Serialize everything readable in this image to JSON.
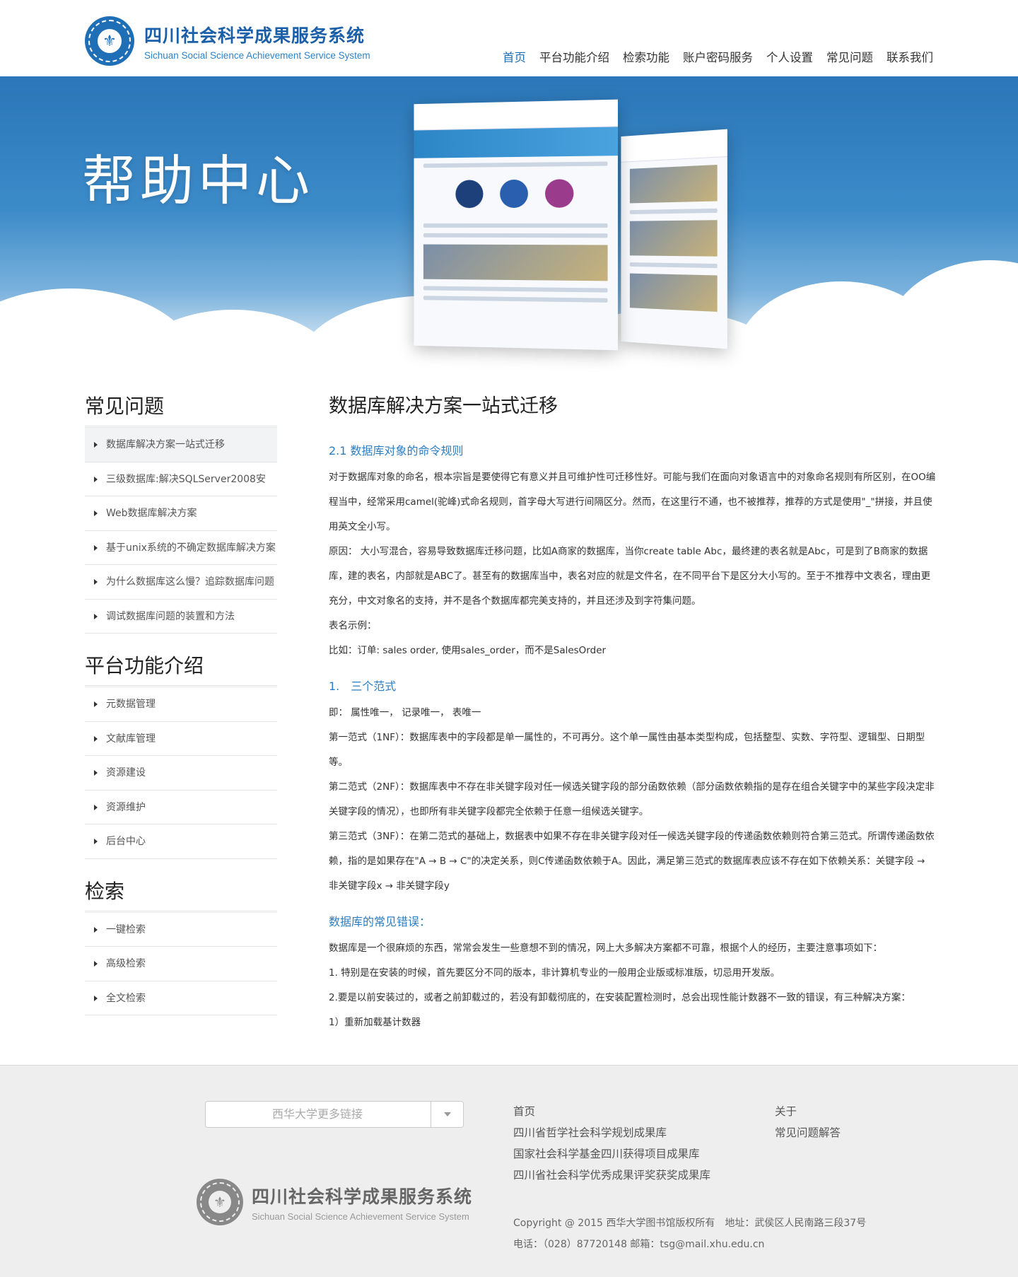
{
  "header": {
    "logo_cn": "四川社会科学成果服务系统",
    "logo_en": "Sichuan Social Science Achievement Service System",
    "nav": [
      "首页",
      "平台功能介绍",
      "检索功能",
      "账户密码服务",
      "个人设置",
      "常见问题",
      "联系我们"
    ],
    "active_nav": "首页"
  },
  "banner": {
    "title": "帮助中心"
  },
  "sidebar": {
    "sections": [
      {
        "title": "常见问题",
        "items": [
          "数据库解决方案一站式迁移",
          "三级数据库:解决SQLServer2008安",
          "Web数据库解决方案",
          "基于unix系统的不确定数据库解决方案",
          "为什么数据库这么慢？追踪数据库问题",
          "调试数据库问题的装置和方法"
        ]
      },
      {
        "title": "平台功能介绍",
        "items": [
          "元数据管理",
          "文献库管理",
          "资源建设",
          "资源维护",
          "后台中心"
        ]
      },
      {
        "title": "检索",
        "items": [
          "一键检索",
          "高级检索",
          "全文检索"
        ]
      }
    ]
  },
  "article": {
    "title": "数据库解决方案一站式迁移",
    "section1": {
      "heading": "2.1 数据库对象的命令规则",
      "paragraphs": [
        "对于数据库对象的命名，根本宗旨是要使得它有意义并且可维护性可迁移性好。可能与我们在面向对象语言中的对象命名规则有所区别，在OO编程当中，经常采用camel(驼峰)式命名规则，首字母大写进行间隔区分。然而，在这里行不通，也不被推荐，推荐的方式是使用\"_\"拼接，并且使用英文全小写。",
        "原因： 大小写混合，容易导致数据库迁移问题，比如A商家的数据库，当你create table Abc，最终建的表名就是Abc，可是到了B商家的数据库，建的表名，内部就是ABC了。甚至有的数据库当中，表名对应的就是文件名，在不同平台下是区分大小写的。至于不推荐中文表名，理由更充分，中文对象名的支持，并不是各个数据库都完美支持的，并且还涉及到字符集问题。",
        "表名示例：",
        "比如：订单: sales order, 使用sales_order，而不是SalesOrder"
      ]
    },
    "section2": {
      "heading": "1.　三个范式",
      "paragraphs": [
        "即： 属性唯一， 记录唯一， 表唯一",
        "第一范式（1NF）：数据库表中的字段都是单一属性的，不可再分。这个单一属性由基本类型构成，包括整型、实数、字符型、逻辑型、日期型等。",
        "第二范式（2NF）：数据库表中不存在非关键字段对任一候选关键字段的部分函数依赖（部分函数依赖指的是存在组合关键字中的某些字段决定非关键字段的情况），也即所有非关键字段都完全依赖于任意一组候选关键字。",
        "第三范式（3NF）：在第二范式的基础上，数据表中如果不存在非关键字段对任一候选关键字段的传递函数依赖则符合第三范式。所谓传递函数依赖，指的是如果存在\"A → B → C\"的决定关系，则C传递函数依赖于A。因此，满足第三范式的数据库表应该不存在如下依赖关系：关键字段 → 非关键字段x → 非关键字段y"
      ]
    },
    "section3": {
      "heading": "数据库的常见错误：",
      "paragraphs": [
        "数据库是一个很麻烦的东西，常常会发生一些意想不到的情况，网上大多解决方案都不可靠，根据个人的经历，主要注意事项如下：",
        "1. 特别是在安装的时候，首先要区分不同的版本，非计算机专业的一般用企业版或标准版，切忌用开发版。",
        "2.要是以前安装过的，或者之前卸载过的，若没有卸载彻底的，在安装配置检测时，总会出现性能计数器不一致的错误，有三种解决方案：",
        "1）重新加载基计数器"
      ]
    }
  },
  "footer": {
    "select_placeholder": "西华大学更多链接",
    "col1": [
      "首页",
      "四川省哲学社会科学规划成果库",
      "国家社会科学基金四川获得项目成果库",
      "四川省社会科学优秀成果评奖获奖成果库"
    ],
    "col2": [
      "关于",
      "常见问题解答"
    ],
    "logo_cn": "四川社会科学成果服务系统",
    "logo_en": "Sichuan Social Science Achievement Service System",
    "copyright": "Copyright @ 2015 西华大学图书馆版权所有　地址：武侯区人民南路三段37号",
    "contact": "电话：（028）87720148 邮箱：tsg@mail.xhu.edu.cn"
  }
}
